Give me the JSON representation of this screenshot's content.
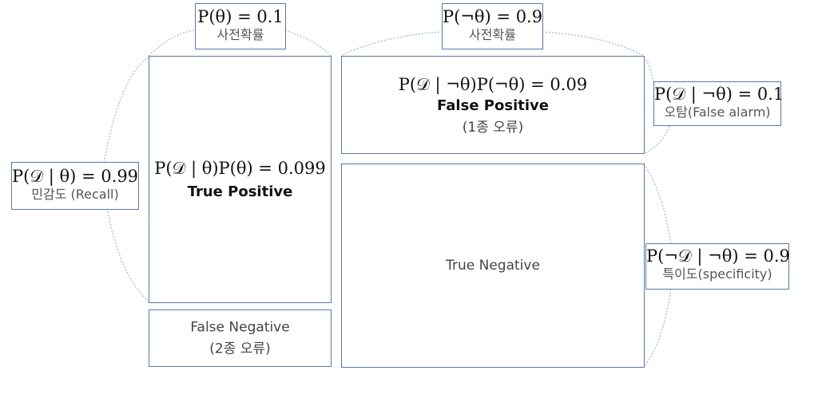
{
  "prior_theta": {
    "formula": "P(θ) = 0.1",
    "caption": "사전확률"
  },
  "prior_not_theta": {
    "formula": "P(¬θ) = 0.9",
    "caption": "사전확률"
  },
  "recall": {
    "formula": "P(𝒟 | θ) = 0.99",
    "caption": "민감도 (Recall)"
  },
  "false_alarm": {
    "formula": "P(𝒟 | ¬θ) = 0.1",
    "caption": "오탐(False alarm)"
  },
  "specificity": {
    "formula": "P(¬𝒟 | ¬θ) = 0.9",
    "caption": "특이도(specificity)"
  },
  "true_positive": {
    "formula": "P(𝒟 | θ)P(θ) = 0.099",
    "name": "True Positive"
  },
  "false_positive": {
    "formula": "P(𝒟 | ¬θ)P(¬θ) = 0.09",
    "name": "False Positive",
    "note": "(1종 오류)"
  },
  "false_negative": {
    "name": "False Negative",
    "note": "(2종 오류)"
  },
  "true_negative": {
    "name": "True Negative"
  },
  "colors": {
    "border": "#5a79a8",
    "arc": "#a9b9d3"
  }
}
